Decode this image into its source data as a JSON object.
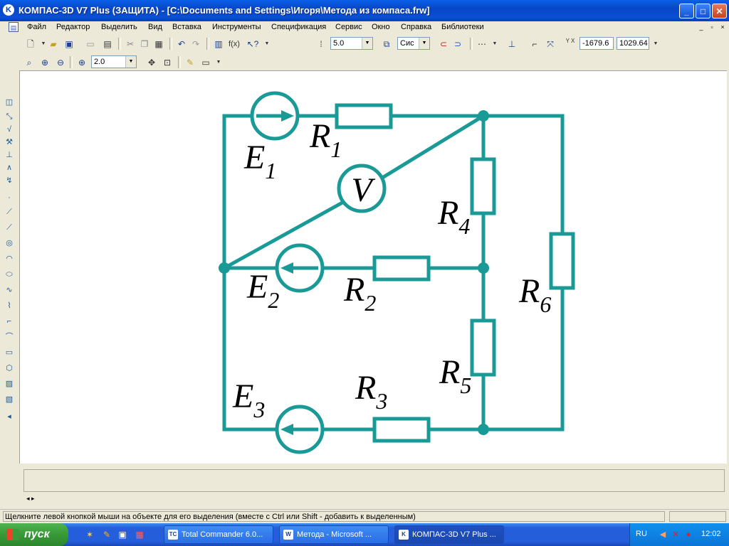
{
  "window": {
    "title": "КОМПАС-3D V7 Plus (ЗАЩИТА) - [C:\\Documents and Settings\\Игоря\\Метода из компаса.frw]",
    "app_icon": "kompas-logo-icon",
    "controls": {
      "minimize": "_",
      "maximize": "□",
      "close": "✕"
    }
  },
  "menu": {
    "items": [
      "Файл",
      "Редактор",
      "Выделить",
      "Вид",
      "Вставка",
      "Инструменты",
      "Спецификация",
      "Сервис",
      "Окно",
      "Справка",
      "Библиотеки"
    ],
    "mdi_controls": {
      "minimize": "_",
      "restore": "▫",
      "close": "×"
    }
  },
  "toolbar1": {
    "step_value": "5.0",
    "layer_value": "Сис",
    "coord_x": "-1679.6",
    "coord_y": "1029.64",
    "coord_label": "Y X"
  },
  "toolbar2": {
    "zoom_value": "2.0"
  },
  "circuit": {
    "sources": [
      {
        "name": "E",
        "sub": "1",
        "arrow": "right"
      },
      {
        "name": "E",
        "sub": "2",
        "arrow": "left"
      },
      {
        "name": "E",
        "sub": "3",
        "arrow": "left"
      }
    ],
    "resistors": [
      {
        "name": "R",
        "sub": "1"
      },
      {
        "name": "R",
        "sub": "2"
      },
      {
        "name": "R",
        "sub": "3"
      },
      {
        "name": "R",
        "sub": "4"
      },
      {
        "name": "R",
        "sub": "5"
      },
      {
        "name": "R",
        "sub": "6"
      }
    ],
    "meter": "V",
    "line_color": "#1a9a96"
  },
  "status": {
    "message": "Щелкните левой кнопкой мыши на объекте для его выделения (вместе с Ctrl или Shift - добавить к выделенным)"
  },
  "taskbar": {
    "start_label": "пуск",
    "tasks": [
      {
        "label": "Total Commander 6.0...",
        "icon": "TC"
      },
      {
        "label": "Метода - Microsoft ...",
        "icon": "W"
      },
      {
        "label": "КОМПАС-3D V7 Plus ...",
        "icon": "K"
      }
    ],
    "language": "RU",
    "clock": "12:02"
  }
}
